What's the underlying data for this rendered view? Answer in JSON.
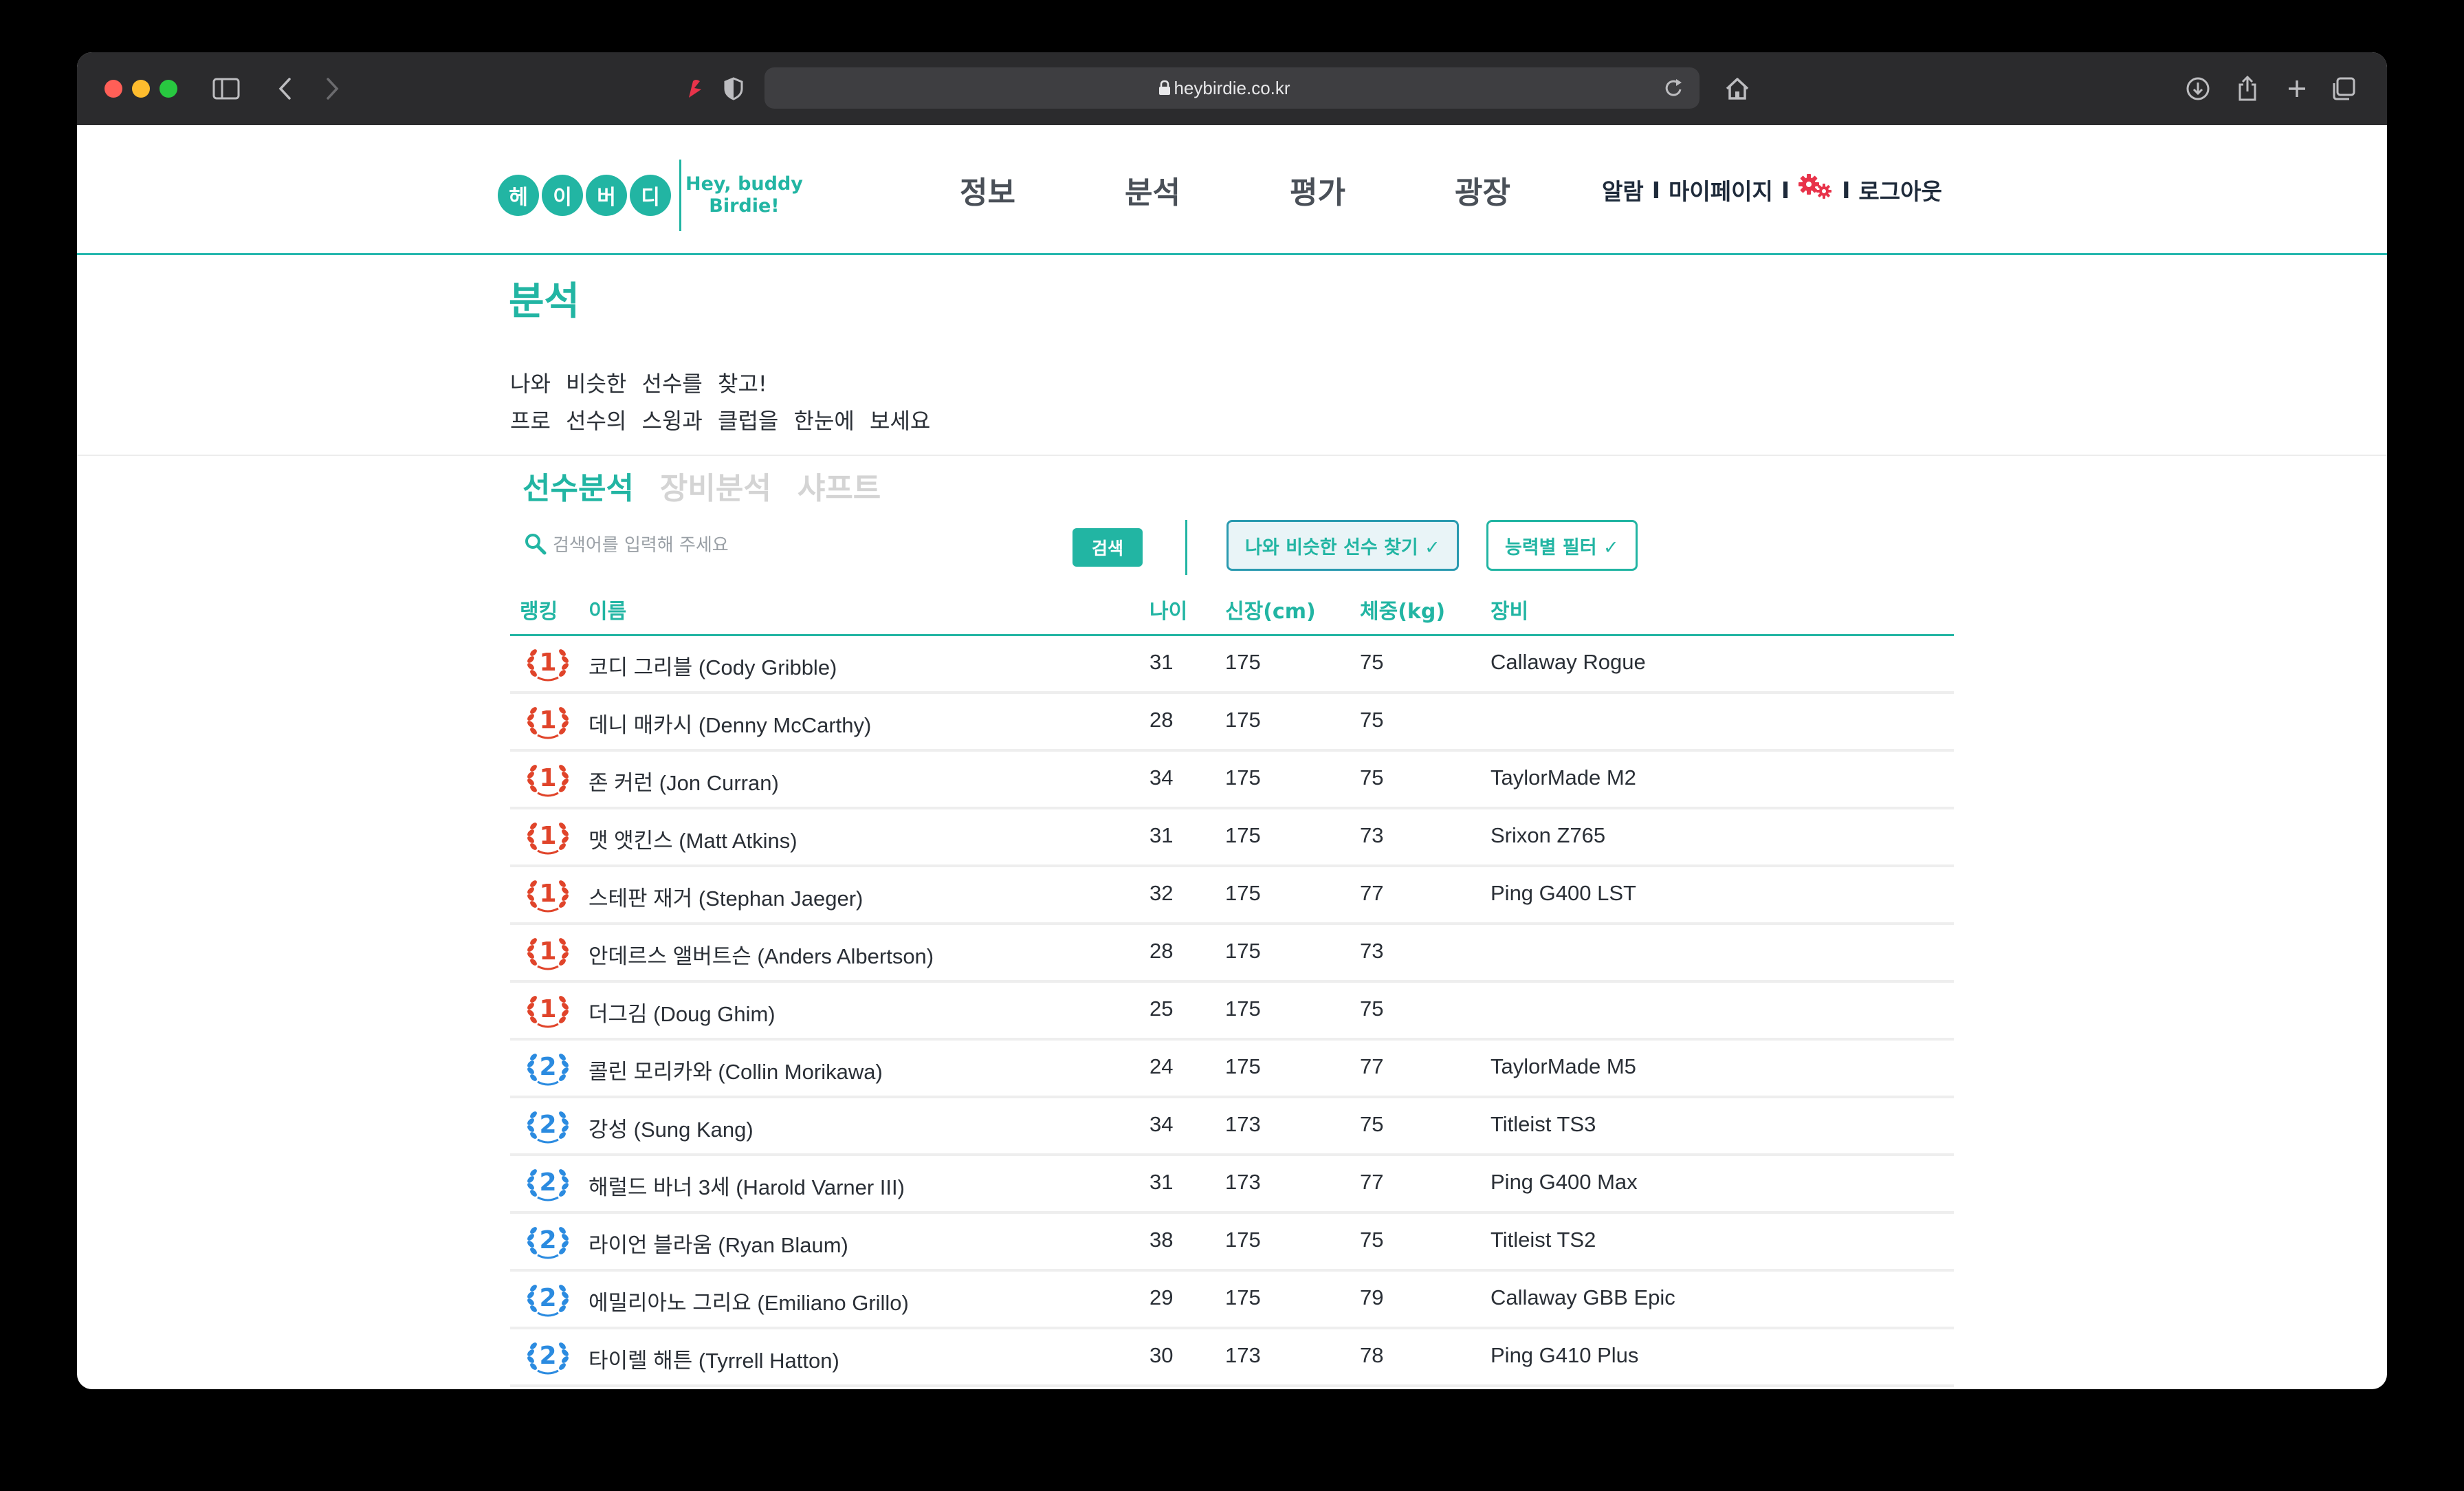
{
  "browser": {
    "url": "heybirdie.co.kr"
  },
  "logo": {
    "chars": [
      "헤",
      "이",
      "버",
      "디"
    ],
    "tagline_1": "Hey, buddy",
    "tagline_2": "Birdie!"
  },
  "nav": {
    "items": [
      "정보",
      "분석",
      "평가",
      "광장"
    ]
  },
  "user_links": {
    "alarm": "알람",
    "mypage": "마이페이지",
    "logout": "로그아웃",
    "sep": "I"
  },
  "page": {
    "title": "분석",
    "desc_line1": "나와 비슷한 선수를 찾고!",
    "desc_line2": "프로 선수의 스윙과 클럽을 한눈에 보세요"
  },
  "tabs": [
    "선수분석",
    "장비분석",
    "샤프트"
  ],
  "search": {
    "placeholder": "검색어를 입력해 주세요",
    "button": "검색"
  },
  "filters": {
    "similar": "나와 비슷한 선수 찾기 ✓",
    "ability": "능력별 필터 ✓"
  },
  "table": {
    "headers": {
      "rank": "랭킹",
      "name": "이름",
      "age": "나이",
      "height": "신장(cm)",
      "weight": "체중(kg)",
      "equipment": "장비"
    },
    "rows": [
      {
        "rank": "1",
        "name": "코디 그리블 (Cody Gribble)",
        "age": "31",
        "height": "175",
        "weight": "75",
        "equipment": "Callaway Rogue"
      },
      {
        "rank": "1",
        "name": "데니 매카시 (Denny McCarthy)",
        "age": "28",
        "height": "175",
        "weight": "75",
        "equipment": ""
      },
      {
        "rank": "1",
        "name": "존 커런 (Jon Curran)",
        "age": "34",
        "height": "175",
        "weight": "75",
        "equipment": "TaylorMade M2"
      },
      {
        "rank": "1",
        "name": "맷 앳킨스 (Matt Atkins)",
        "age": "31",
        "height": "175",
        "weight": "73",
        "equipment": "Srixon Z765"
      },
      {
        "rank": "1",
        "name": "스테판 재거 (Stephan Jaeger)",
        "age": "32",
        "height": "175",
        "weight": "77",
        "equipment": "Ping G400 LST"
      },
      {
        "rank": "1",
        "name": "안데르스 앨버트슨 (Anders Albertson)",
        "age": "28",
        "height": "175",
        "weight": "73",
        "equipment": ""
      },
      {
        "rank": "1",
        "name": "더그김 (Doug Ghim)",
        "age": "25",
        "height": "175",
        "weight": "75",
        "equipment": ""
      },
      {
        "rank": "2",
        "name": "콜린 모리카와 (Collin Morikawa)",
        "age": "24",
        "height": "175",
        "weight": "77",
        "equipment": "TaylorMade M5"
      },
      {
        "rank": "2",
        "name": "강성 (Sung Kang)",
        "age": "34",
        "height": "173",
        "weight": "75",
        "equipment": "Titleist TS3"
      },
      {
        "rank": "2",
        "name": "해럴드 바너 3세 (Harold Varner III)",
        "age": "31",
        "height": "173",
        "weight": "77",
        "equipment": "Ping G400 Max"
      },
      {
        "rank": "2",
        "name": "라이언 블라움 (Ryan Blaum)",
        "age": "38",
        "height": "175",
        "weight": "75",
        "equipment": "Titleist TS2"
      },
      {
        "rank": "2",
        "name": "에밀리아노 그리요 (Emiliano Grillo)",
        "age": "29",
        "height": "175",
        "weight": "79",
        "equipment": "Callaway GBB Epic"
      },
      {
        "rank": "2",
        "name": "타이렐 해튼 (Tyrrell Hatton)",
        "age": "30",
        "height": "173",
        "weight": "78",
        "equipment": "Ping G410 Plus"
      }
    ]
  },
  "colors": {
    "accent": "#22b5a3",
    "rank1": "#e0442a",
    "rank2": "#2b8be0",
    "gear": "#e8334a"
  },
  "icons": {
    "sidebar": "sidebar-icon",
    "back": "chevron-left-icon",
    "forward": "chevron-right-icon",
    "shield": "shield-icon",
    "lock": "lock-icon",
    "reload": "reload-icon",
    "home": "home-icon",
    "download": "download-icon",
    "share": "share-icon",
    "new_tab": "plus-icon",
    "tabs": "tabs-overview-icon",
    "gear": "gear-icon",
    "search": "search-icon",
    "rank_badge": "laurel-badge-icon"
  }
}
